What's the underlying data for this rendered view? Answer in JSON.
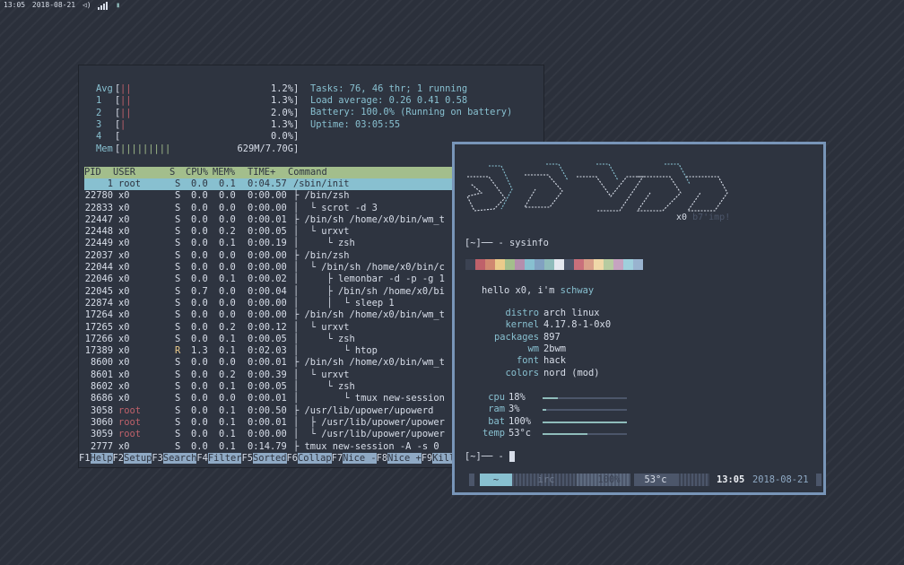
{
  "topbar": {
    "clock": "13:05",
    "date": "2018-08-21"
  },
  "htop": {
    "meters": {
      "cpus": [
        {
          "label": "Avg",
          "bars": "||",
          "value": "1.2%"
        },
        {
          "label": "1",
          "bars": "||",
          "value": "1.3%"
        },
        {
          "label": "2",
          "bars": "||",
          "value": "2.0%"
        },
        {
          "label": "3",
          "bars": "|",
          "value": "1.3%"
        },
        {
          "label": "4",
          "bars": "",
          "value": "0.0%"
        }
      ],
      "mem": {
        "label": "Mem",
        "bars": "|||||||||",
        "value": "629M/7.70G"
      }
    },
    "stats": {
      "tasks": "Tasks: 76, 46 thr; 1 running",
      "load": "Load average: 0.26 0.41 0.58",
      "battery": "Battery: 100.0% (Running on battery)",
      "uptime": "Uptime: 03:05:55"
    },
    "columns": [
      "PID",
      "USER",
      "S",
      "CPU%",
      "MEM%",
      "TIME+",
      "Command"
    ],
    "processes": [
      {
        "pid": "1",
        "user": "root",
        "s": "S",
        "cpu": "0.0",
        "mem": "0.1",
        "time": "0:04.57",
        "cmd": "/sbin/init",
        "tree": ""
      },
      {
        "pid": "22780",
        "user": "x0",
        "s": "S",
        "cpu": "0.0",
        "mem": "0.0",
        "time": "0:00.00",
        "cmd": "/bin/zsh",
        "tree": "├ "
      },
      {
        "pid": "22833",
        "user": "x0",
        "s": "S",
        "cpu": "0.0",
        "mem": "0.0",
        "time": "0:00.00",
        "cmd": "scrot -d 3",
        "tree": "│  └ "
      },
      {
        "pid": "22447",
        "user": "x0",
        "s": "S",
        "cpu": "0.0",
        "mem": "0.0",
        "time": "0:00.01",
        "cmd": "/bin/sh /home/x0/bin/wm_t",
        "tree": "├ "
      },
      {
        "pid": "22448",
        "user": "x0",
        "s": "S",
        "cpu": "0.0",
        "mem": "0.2",
        "time": "0:00.05",
        "cmd": "urxvt",
        "tree": "│  └ "
      },
      {
        "pid": "22449",
        "user": "x0",
        "s": "S",
        "cpu": "0.0",
        "mem": "0.1",
        "time": "0:00.19",
        "cmd": "zsh",
        "tree": "│     └ "
      },
      {
        "pid": "22037",
        "user": "x0",
        "s": "S",
        "cpu": "0.0",
        "mem": "0.0",
        "time": "0:00.00",
        "cmd": "/bin/zsh",
        "tree": "├ "
      },
      {
        "pid": "22044",
        "user": "x0",
        "s": "S",
        "cpu": "0.0",
        "mem": "0.0",
        "time": "0:00.00",
        "cmd": "/bin/sh /home/x0/bin/c",
        "tree": "│  └ "
      },
      {
        "pid": "22046",
        "user": "x0",
        "s": "S",
        "cpu": "0.0",
        "mem": "0.1",
        "time": "0:00.02",
        "cmd": "lemonbar -d -p -g 1",
        "tree": "│     ├ "
      },
      {
        "pid": "22045",
        "user": "x0",
        "s": "S",
        "cpu": "0.7",
        "mem": "0.0",
        "time": "0:00.04",
        "cmd": "/bin/sh /home/x0/bi",
        "tree": "│     ├ "
      },
      {
        "pid": "22874",
        "user": "x0",
        "s": "S",
        "cpu": "0.0",
        "mem": "0.0",
        "time": "0:00.00",
        "cmd": "sleep 1",
        "tree": "│     │  └ "
      },
      {
        "pid": "17264",
        "user": "x0",
        "s": "S",
        "cpu": "0.0",
        "mem": "0.0",
        "time": "0:00.00",
        "cmd": "/bin/sh /home/x0/bin/wm_t",
        "tree": "├ "
      },
      {
        "pid": "17265",
        "user": "x0",
        "s": "S",
        "cpu": "0.0",
        "mem": "0.2",
        "time": "0:00.12",
        "cmd": "urxvt",
        "tree": "│  └ "
      },
      {
        "pid": "17266",
        "user": "x0",
        "s": "S",
        "cpu": "0.0",
        "mem": "0.1",
        "time": "0:00.05",
        "cmd": "zsh",
        "tree": "│     └ "
      },
      {
        "pid": "17389",
        "user": "x0",
        "s": "R",
        "cpu": "1.3",
        "mem": "0.1",
        "time": "0:02.03",
        "cmd": "htop",
        "tree": "│        └ "
      },
      {
        "pid": "8600",
        "user": "x0",
        "s": "S",
        "cpu": "0.0",
        "mem": "0.0",
        "time": "0:00.01",
        "cmd": "/bin/sh /home/x0/bin/wm_t",
        "tree": "├ "
      },
      {
        "pid": "8601",
        "user": "x0",
        "s": "S",
        "cpu": "0.0",
        "mem": "0.2",
        "time": "0:00.39",
        "cmd": "urxvt",
        "tree": "│  └ "
      },
      {
        "pid": "8602",
        "user": "x0",
        "s": "S",
        "cpu": "0.0",
        "mem": "0.1",
        "time": "0:00.05",
        "cmd": "zsh",
        "tree": "│     └ "
      },
      {
        "pid": "8686",
        "user": "x0",
        "s": "S",
        "cpu": "0.0",
        "mem": "0.0",
        "time": "0:00.01",
        "cmd": "tmux new-session",
        "tree": "│        └ "
      },
      {
        "pid": "3058",
        "user": "root",
        "s": "S",
        "cpu": "0.0",
        "mem": "0.1",
        "time": "0:00.50",
        "cmd": "/usr/lib/upower/upowerd",
        "tree": "├ "
      },
      {
        "pid": "3060",
        "user": "root",
        "s": "S",
        "cpu": "0.0",
        "mem": "0.1",
        "time": "0:00.01",
        "cmd": "/usr/lib/upower/upower",
        "tree": "│  ├ "
      },
      {
        "pid": "3059",
        "user": "root",
        "s": "S",
        "cpu": "0.0",
        "mem": "0.1",
        "time": "0:00.00",
        "cmd": "/usr/lib/upower/upower",
        "tree": "│  └ "
      },
      {
        "pid": "2777",
        "user": "x0",
        "s": "S",
        "cpu": "0.0",
        "mem": "0.1",
        "time": "0:14.79",
        "cmd": "tmux new-session -A -s 0",
        "tree": "├ "
      }
    ],
    "fkeys": [
      {
        "key": "F1",
        "label": "Help  "
      },
      {
        "key": "F2",
        "label": "Setup "
      },
      {
        "key": "F3",
        "label": "Search"
      },
      {
        "key": "F4",
        "label": "Filter"
      },
      {
        "key": "F5",
        "label": "Sorted"
      },
      {
        "key": "F6",
        "label": "Collap"
      },
      {
        "key": "F7",
        "label": "Nice -"
      },
      {
        "key": "F8",
        "label": "Nice +"
      },
      {
        "key": "F9",
        "label": "Kill  "
      }
    ]
  },
  "terminal": {
    "logo_signature": "x0",
    "logo_tag": "b7'imp!",
    "prompt1": "[~]── - sysinfo",
    "greeting_prefix": "hello x0, i'm ",
    "greeting_name": "schway",
    "info": [
      {
        "key": "distro",
        "value": "arch linux"
      },
      {
        "key": "kernel",
        "value": "4.17.8-1-0x0"
      },
      {
        "key": "packages",
        "value": "897"
      },
      {
        "key": "wm",
        "value": "2bwm"
      },
      {
        "key": "font",
        "value": "hack"
      },
      {
        "key": "colors",
        "value": "nord (mod)"
      }
    ],
    "usage": [
      {
        "label": "cpu",
        "value": "18%",
        "fraction": 0.18
      },
      {
        "label": "ram",
        "value": "3%",
        "fraction": 0.03
      },
      {
        "label": "bat",
        "value": "100%",
        "fraction": 1.0
      },
      {
        "label": "temp",
        "value": "53°c",
        "fraction": 0.53
      }
    ],
    "prompt2": "[~]── - ",
    "tmux_bar": {
      "window1": "~",
      "window2": "irc",
      "battery": "100%",
      "temp": "53°c",
      "clock": "13:05",
      "date": "2018-08-21"
    },
    "palette": [
      "#3b4252",
      "#bf616a",
      "#d08770",
      "#ebcb8b",
      "#a3be8c",
      "#b48ead",
      "#88c0d0",
      "#81a1c1",
      "#8fbcbb",
      "#e5e9f0",
      "#4c566a",
      "#c9707b",
      "#d9a08a",
      "#f0d8a8",
      "#b6cba0",
      "#c6a3c0",
      "#9fcfdc",
      "#99b3cf"
    ]
  }
}
